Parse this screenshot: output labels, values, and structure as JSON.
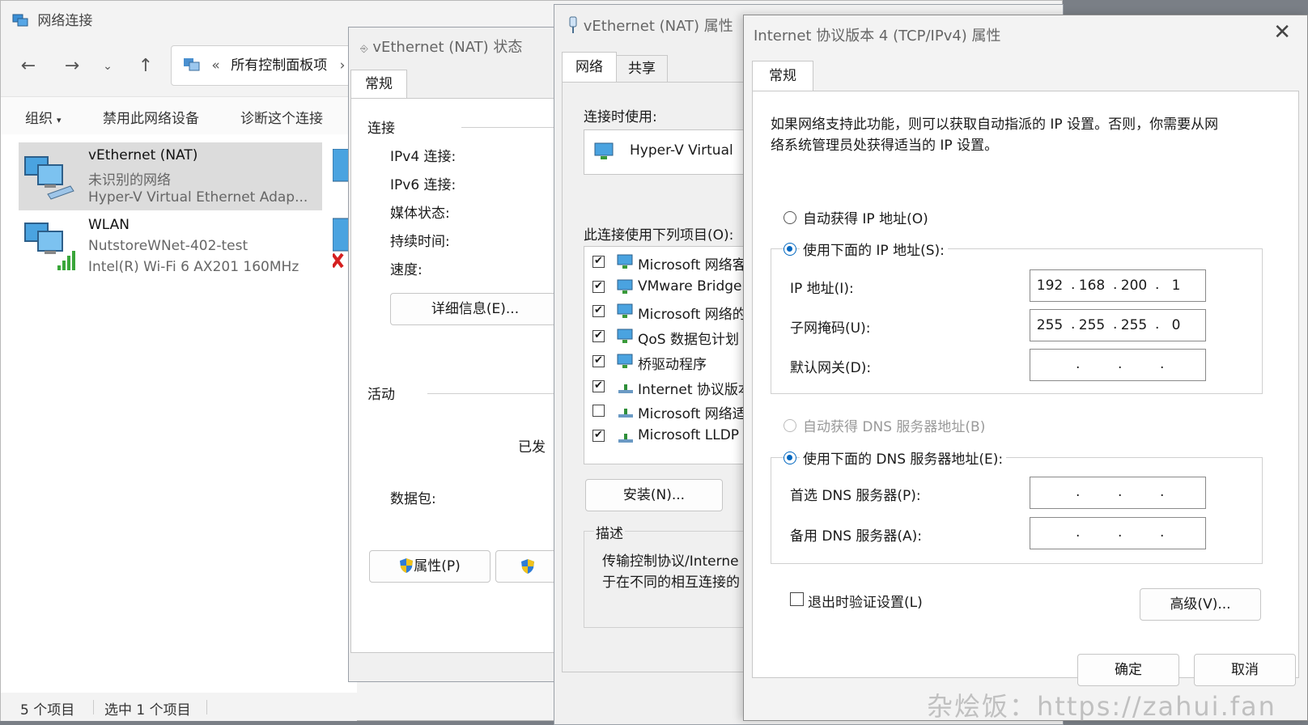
{
  "explorer": {
    "title": "网络连接",
    "address": "所有控制面板项",
    "address_sep": "«",
    "commands": [
      "组织",
      "禁用此网络设备",
      "诊断这个连接"
    ],
    "connections": [
      {
        "name": "vEthernet (NAT)",
        "status": "未识别的网络",
        "device": "Hyper-V Virtual Ethernet Adap..."
      },
      {
        "name": "WLAN",
        "status": "NutstoreWNet-402-test",
        "device": "Intel(R) Wi-Fi 6 AX201 160MHz"
      }
    ],
    "status_items": "5 个项目",
    "status_selected": "选中 1 个项目"
  },
  "status_dialog": {
    "title": "vEthernet (NAT) 状态",
    "tab": "常规",
    "section_connection": "连接",
    "labels": [
      "IPv4 连接:",
      "IPv6 连接:",
      "媒体状态:",
      "持续时间:",
      "速度:"
    ],
    "details_button": "详细信息(E)...",
    "section_activity": "活动",
    "sent_label": "已发",
    "packets_label": "数据包:",
    "properties_button": "属性(P)"
  },
  "nat_props": {
    "title": "vEthernet (NAT) 属性",
    "tabs": [
      "网络",
      "共享"
    ],
    "connect_using_label": "连接时使用:",
    "adapter": "Hyper-V Virtual",
    "items_label": "此连接使用下列项目(O):",
    "items": [
      {
        "label": "Microsoft 网络客",
        "checked": "✔"
      },
      {
        "label": "VMware Bridge",
        "checked": "✔"
      },
      {
        "label": "Microsoft 网络的",
        "checked": "✔"
      },
      {
        "label": "QoS 数据包计划",
        "checked": "✔"
      },
      {
        "label": "桥驱动程序",
        "checked": "✔"
      },
      {
        "label": "Internet 协议版本",
        "checked": "✔"
      },
      {
        "label": "Microsoft 网络适",
        "checked": ""
      },
      {
        "label": "Microsoft LLDP",
        "checked": "✔"
      }
    ],
    "install_button": "安装(N)...",
    "description_label": "描述",
    "description_line1": "传输控制协议/Interne",
    "description_line2": "于在不同的相互连接的"
  },
  "ipv4": {
    "title": "Internet 协议版本 4 (TCP/IPv4) 属性",
    "tab": "常规",
    "intro_line1": "如果网络支持此功能，则可以获取自动指派的 IP 设置。否则，你需要从网",
    "intro_line2": "络系统管理员处获得适当的 IP 设置。",
    "auto_ip": "自动获得 IP 地址(O)",
    "manual_ip": "使用下面的 IP 地址(S):",
    "ip_label": "IP 地址(I):",
    "ip": [
      "192",
      "168",
      "200",
      "1"
    ],
    "mask_label": "子网掩码(U):",
    "mask": [
      "255",
      "255",
      "255",
      "0"
    ],
    "gateway_label": "默认网关(D):",
    "auto_dns": "自动获得 DNS 服务器地址(B)",
    "manual_dns": "使用下面的 DNS 服务器地址(E):",
    "dns1_label": "首选 DNS 服务器(P):",
    "dns2_label": "备用 DNS 服务器(A):",
    "validate_label": "退出时验证设置(L)",
    "advanced_button": "高级(V)...",
    "ok_button": "确定",
    "cancel_button": "取消"
  },
  "watermark": "杂烩饭：https://zahui.fan",
  "colors": {
    "accent": "#0067c0",
    "selection": "#dcdcdc"
  }
}
